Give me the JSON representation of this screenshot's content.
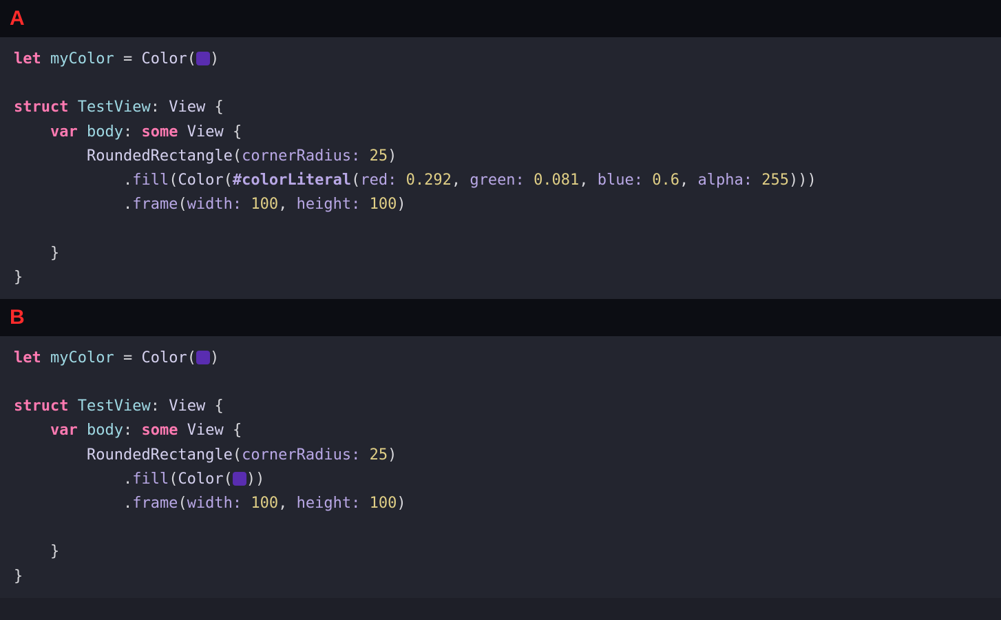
{
  "panes": [
    "A",
    "B"
  ],
  "labels": {
    "A": "A",
    "B": "B"
  },
  "code": {
    "let": "let",
    "struct": "struct",
    "var": "var",
    "some": "some",
    "myColor": "myColor",
    "eq": "=",
    "Color": "Color",
    "lp": "(",
    "rp": ")",
    "TestView": "TestView",
    "colon": ":",
    "View": "View",
    "lb": "{",
    "rb": "}",
    "body": "body",
    "RoundedRectangle": "RoundedRectangle",
    "cornerRadius": "cornerRadius:",
    "n25": "25",
    "dot": ".",
    "fill": "fill",
    "colorLiteral": "#colorLiteral",
    "red": "red:",
    "green": "green:",
    "blue": "blue:",
    "alpha": "alpha:",
    "v_red": "0.292",
    "v_green": "0.081",
    "v_blue": "0.6",
    "v_alpha": "255",
    "comma": ",",
    "frame": "frame",
    "width": "width:",
    "height": "height:",
    "n100": "100",
    "swatchColor": "#592db0"
  }
}
